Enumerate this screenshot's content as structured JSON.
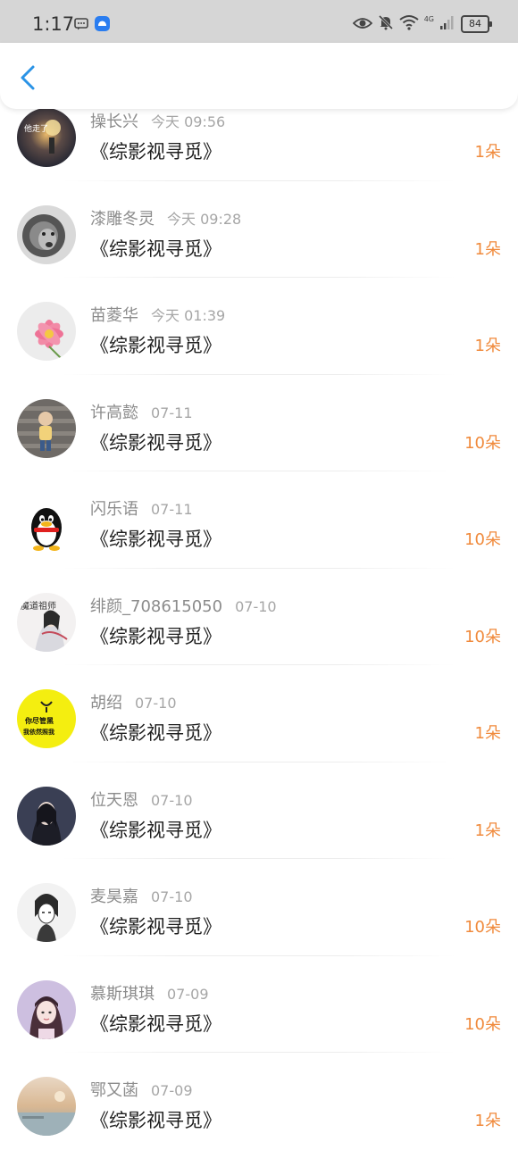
{
  "status_bar": {
    "time": "1:17",
    "network": "4G",
    "battery": "84",
    "icons": [
      "message-icon",
      "app-notification-icon",
      "eye-icon",
      "mute-icon",
      "wifi-icon",
      "signal-icon",
      "battery-icon"
    ]
  },
  "header": {
    "back_icon": "chevron-left-icon",
    "accent_color": "#2a93e6"
  },
  "colors": {
    "count": "#f08a3c",
    "name": "#8c8c8c",
    "time": "#a6a6a6",
    "title": "#1f1f1f"
  },
  "rows": [
    {
      "name": "操长兴",
      "time": "今天 09:56",
      "title": "《综影视寻觅》",
      "count": "1朵"
    },
    {
      "name": "漆雕冬灵",
      "time": "今天 09:28",
      "title": "《综影视寻觅》",
      "count": "1朵"
    },
    {
      "name": "苗菱华",
      "time": "今天 01:39",
      "title": "《综影视寻觅》",
      "count": "1朵"
    },
    {
      "name": "许高懿",
      "time": "07-11",
      "title": "《综影视寻觅》",
      "count": "10朵"
    },
    {
      "name": "闪乐语",
      "time": "07-11",
      "title": "《综影视寻觅》",
      "count": "10朵"
    },
    {
      "name": "绯颜_708615050",
      "time": "07-10",
      "title": "《综影视寻觅》",
      "count": "10朵"
    },
    {
      "name": "胡绍",
      "time": "07-10",
      "title": "《综影视寻觅》",
      "count": "1朵"
    },
    {
      "name": "位天恩",
      "time": "07-10",
      "title": "《综影视寻觅》",
      "count": "1朵"
    },
    {
      "name": "麦昊嘉",
      "time": "07-10",
      "title": "《综影视寻觅》",
      "count": "10朵"
    },
    {
      "name": "慕斯琪琪",
      "time": "07-09",
      "title": "《综影视寻觅》",
      "count": "10朵"
    },
    {
      "name": "鄂又菡",
      "time": "07-09",
      "title": "《综影视寻觅》",
      "count": "1朵"
    }
  ],
  "avatar_texts": {
    "row1": "他走了",
    "row6": "魔道祖师",
    "row7_line1": "你尽管黑",
    "row7_line2": "我依然照我"
  }
}
